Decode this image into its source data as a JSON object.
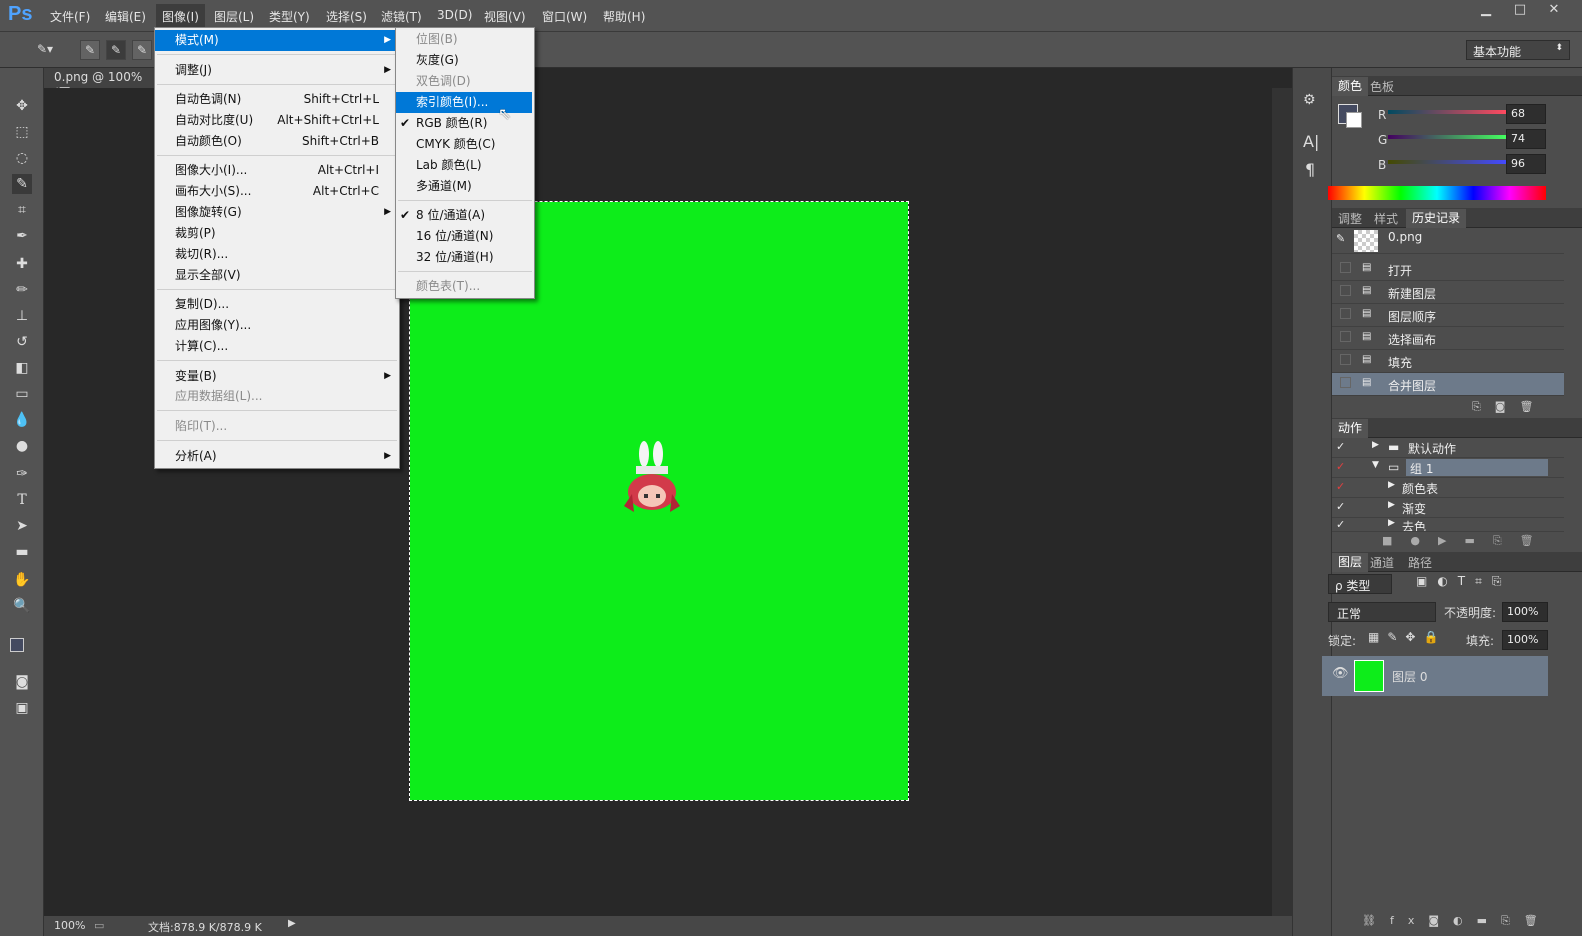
{
  "app": {
    "logo": "Ps"
  },
  "menubar": [
    "文件(F)",
    "编辑(E)",
    "图像(I)",
    "图层(L)",
    "类型(Y)",
    "选择(S)",
    "滤镜(T)",
    "3D(D)",
    "视图(V)",
    "窗口(W)",
    "帮助(H)"
  ],
  "window_controls": {
    "minimize": "▁",
    "maximize": "□",
    "close": "✕"
  },
  "workspace": "基本功能",
  "document": {
    "tab": "0.png @ 100% (图",
    "zoom": "100%",
    "doc_size": "文档:878.9 K/878.9 K",
    "canvas_color": "#0ded1a"
  },
  "image_menu": {
    "items": [
      {
        "label": "模式(M)",
        "shortcut": "",
        "submenu": true,
        "highlighted": true
      },
      {
        "label": "调整(J)",
        "shortcut": "",
        "submenu": true
      },
      {
        "label": "自动色调(N)",
        "shortcut": "Shift+Ctrl+L"
      },
      {
        "label": "自动对比度(U)",
        "shortcut": "Alt+Shift+Ctrl+L"
      },
      {
        "label": "自动颜色(O)",
        "shortcut": "Shift+Ctrl+B"
      },
      {
        "label": "图像大小(I)...",
        "shortcut": "Alt+Ctrl+I"
      },
      {
        "label": "画布大小(S)...",
        "shortcut": "Alt+Ctrl+C"
      },
      {
        "label": "图像旋转(G)",
        "shortcut": "",
        "submenu": true
      },
      {
        "label": "裁剪(P)",
        "shortcut": ""
      },
      {
        "label": "裁切(R)...",
        "shortcut": ""
      },
      {
        "label": "显示全部(V)",
        "shortcut": ""
      },
      {
        "label": "复制(D)...",
        "shortcut": ""
      },
      {
        "label": "应用图像(Y)...",
        "shortcut": ""
      },
      {
        "label": "计算(C)...",
        "shortcut": ""
      },
      {
        "label": "变量(B)",
        "shortcut": "",
        "submenu": true
      },
      {
        "label": "应用数据组(L)...",
        "shortcut": "",
        "disabled": true
      },
      {
        "label": "陷印(T)...",
        "shortcut": "",
        "disabled": true
      },
      {
        "label": "分析(A)",
        "shortcut": "",
        "submenu": true
      }
    ]
  },
  "mode_menu": {
    "items": [
      {
        "label": "位图(B)",
        "disabled": true
      },
      {
        "label": "灰度(G)"
      },
      {
        "label": "双色调(D)",
        "disabled": true
      },
      {
        "label": "索引颜色(I)...",
        "highlighted": true
      },
      {
        "label": "RGB 颜色(R)",
        "checked": true
      },
      {
        "label": "CMYK 颜色(C)"
      },
      {
        "label": "Lab 颜色(L)"
      },
      {
        "label": "多通道(M)"
      },
      {
        "label": "8 位/通道(A)",
        "checked": true
      },
      {
        "label": "16 位/通道(N)"
      },
      {
        "label": "32 位/通道(H)"
      },
      {
        "label": "颜色表(T)...",
        "disabled": true
      }
    ]
  },
  "color_panel": {
    "tabs": [
      "颜色",
      "色板"
    ],
    "channels": [
      {
        "name": "R",
        "value": "68"
      },
      {
        "name": "G",
        "value": "74"
      },
      {
        "name": "B",
        "value": "96"
      }
    ],
    "foreground": "#444a60"
  },
  "history_panel": {
    "tabs": [
      "调整",
      "样式",
      "历史记录"
    ],
    "snapshot": "0.png",
    "items": [
      "打开",
      "新建图层",
      "图层顺序",
      "选择画布",
      "填充",
      "合并图层"
    ]
  },
  "actions_panel": {
    "title": "动作",
    "items": [
      {
        "label": "默认动作",
        "indent": 0
      },
      {
        "label": "组 1",
        "indent": 0
      },
      {
        "label": "颜色表",
        "indent": 1
      },
      {
        "label": "渐变",
        "indent": 1
      },
      {
        "label": "去色",
        "indent": 1
      }
    ]
  },
  "layers_panel": {
    "tabs": [
      "图层",
      "通道",
      "路径"
    ],
    "filter": "ρ 类型",
    "blend_mode": "正常",
    "opacity_label": "不透明度:",
    "opacity": "100%",
    "lock_label": "锁定:",
    "fill_label": "填充:",
    "fill": "100%",
    "layer_name": "图层 0"
  }
}
